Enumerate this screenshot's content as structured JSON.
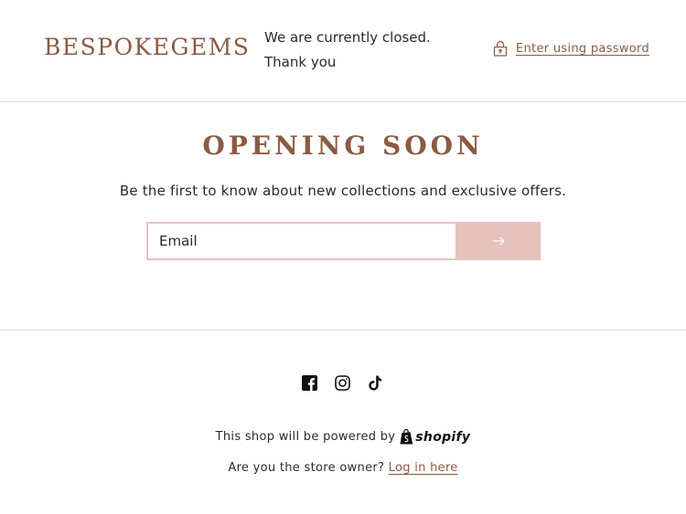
{
  "header": {
    "logo": "BESPOKEGEMS",
    "closed_line1": "We are currently closed.",
    "closed_line2": "Thank you",
    "password_link": "Enter using password"
  },
  "hero": {
    "title": "OPENING SOON",
    "subtitle": "Be the first to know about new collections and exclusive offers."
  },
  "newsletter": {
    "email_placeholder": "Email",
    "submit_icon": "arrow-right-icon"
  },
  "social": [
    "facebook-icon",
    "instagram-icon",
    "tiktok-icon"
  ],
  "footer": {
    "powered_text": "This shop will be powered by",
    "shopify_brand": "shopify",
    "owner_text": "Are you the store owner?",
    "login_link": "Log in here"
  },
  "colors": {
    "brand": "#8a5a44",
    "accent_pink": "#e6c2bd",
    "text": "#2a2a2a",
    "divider": "#d9d9d9"
  }
}
